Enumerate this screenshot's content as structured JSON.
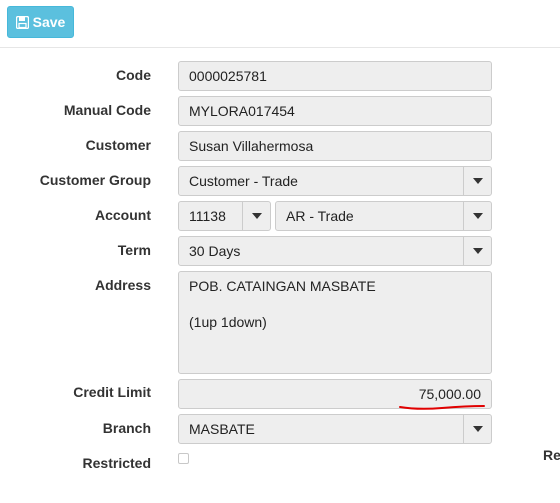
{
  "toolbar": {
    "save_label": "Save",
    "save_icon": "floppy-disk-icon",
    "save_color": "#5bc0de"
  },
  "form": {
    "code": {
      "label": "Code",
      "value": "0000025781"
    },
    "manual_code": {
      "label": "Manual Code",
      "value": "MYLORA017454"
    },
    "customer": {
      "label": "Customer",
      "value": "Susan Villahermosa"
    },
    "customer_group": {
      "label": "Customer Group",
      "value": "Customer - Trade"
    },
    "account": {
      "label": "Account",
      "code": "11138",
      "name": "AR - Trade"
    },
    "term": {
      "label": "Term",
      "value": "30 Days"
    },
    "address": {
      "label": "Address",
      "line1": "POB. CATAINGAN MASBATE",
      "line2": "(1up 1down)"
    },
    "credit_limit": {
      "label": "Credit Limit",
      "value": "75,000.00",
      "annotation_color": "#e00000"
    },
    "branch": {
      "label": "Branch",
      "value": "MASBATE"
    },
    "restricted": {
      "label": "Restricted",
      "checked": false
    },
    "right_column_label": "Re"
  }
}
